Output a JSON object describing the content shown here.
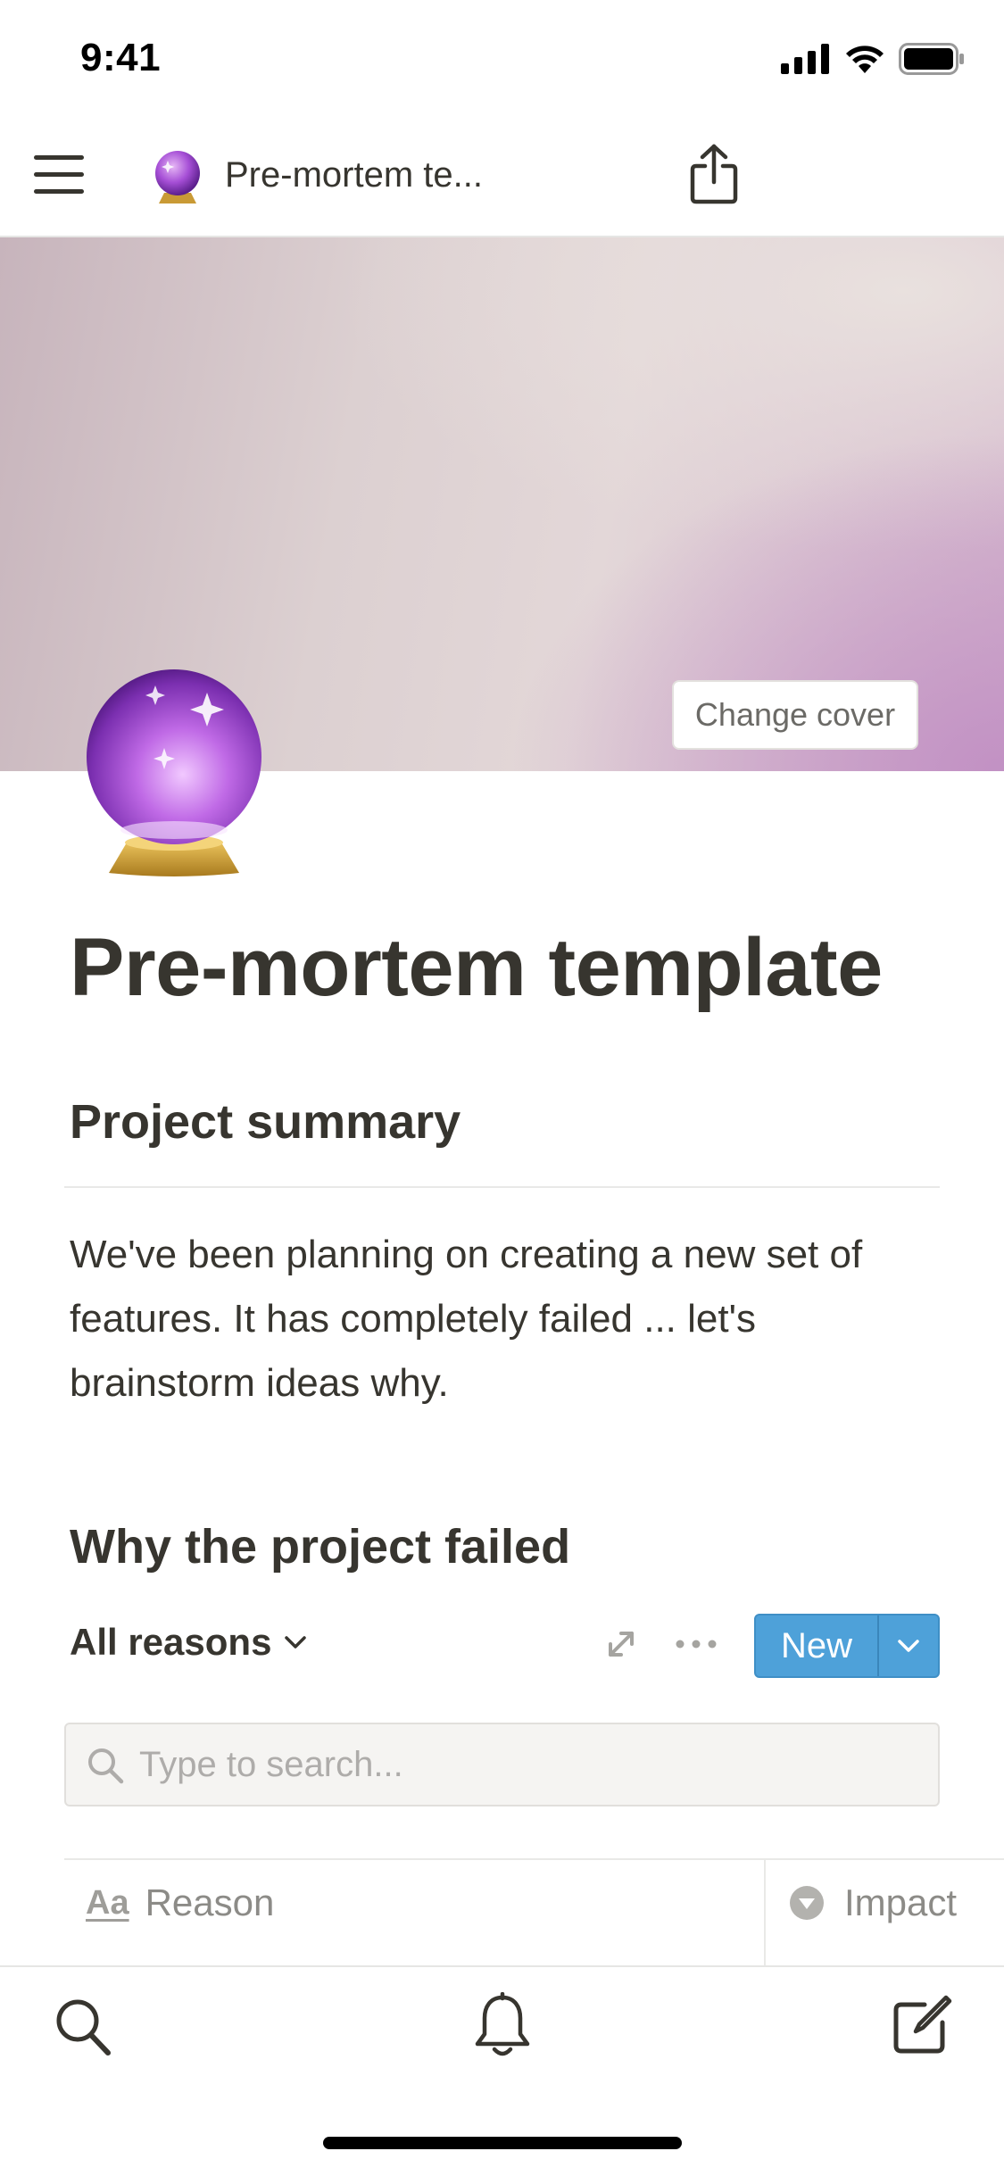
{
  "status_bar": {
    "time": "9:41"
  },
  "nav": {
    "breadcrumb": "Pre-mortem te...",
    "menu_icon": "hamburger-menu-icon",
    "share_icon": "share-icon",
    "page_icon": "crystal-ball-icon"
  },
  "cover": {
    "change_cover_label": "Change cover"
  },
  "page": {
    "title": "Pre-mortem template",
    "summary_heading": "Project summary",
    "summary_text": "We've been planning on creating a new set of features. It has completely failed ... let's brainstorm ideas why.",
    "failed_heading": "Why the project failed"
  },
  "database": {
    "view_label": "All reasons",
    "new_label": "New",
    "search_placeholder": "Type to search...",
    "columns": [
      {
        "label": "Reason",
        "icon_text": "Aa",
        "icon": "title-property-icon"
      },
      {
        "label": "Impact",
        "icon": "select-property-icon"
      }
    ],
    "accent_color": "#4ea1d9"
  },
  "tab_bar": {
    "items": [
      {
        "icon": "search-icon"
      },
      {
        "icon": "bell-icon"
      },
      {
        "icon": "compose-icon"
      }
    ]
  }
}
